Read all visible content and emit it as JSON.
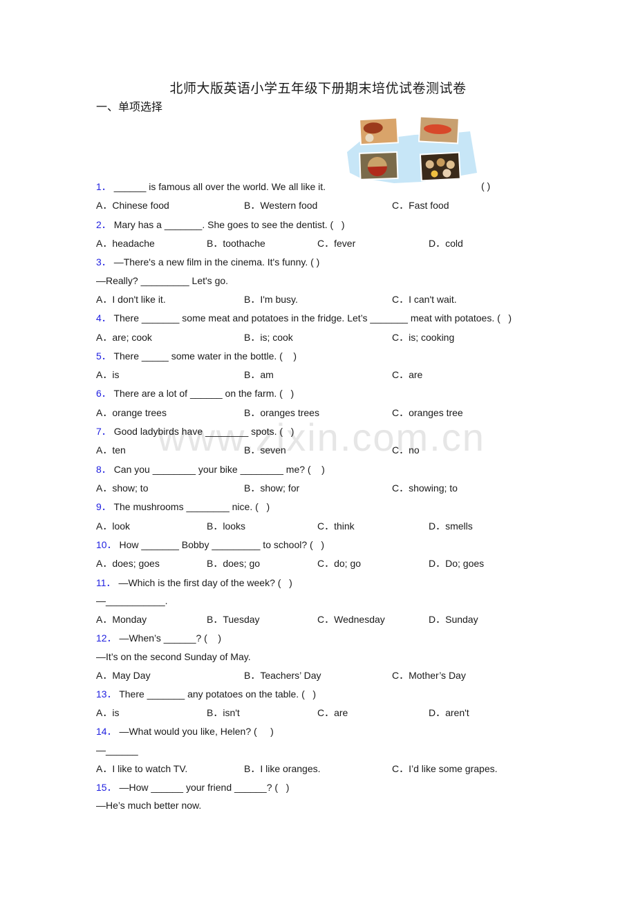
{
  "document": {
    "title": "北师大版英语小学五年级下册期末培优试卷测试卷",
    "section_heading": "一、单项选择",
    "watermark": "www.zixin.com.cn",
    "image_alt": "food-collage-image",
    "number_color": "#2020e0"
  },
  "questions": [
    {
      "num": "1．",
      "lines": [
        "______ is famous all over the world. We all like it."
      ],
      "trailing": "( )",
      "options": [
        "A．Chinese food",
        "B．Western food",
        "C．Fast food"
      ]
    },
    {
      "num": "2．",
      "lines": [
        "Mary has a _______. She goes to see the dentist. (   )"
      ],
      "options": [
        "A．headache",
        "B．toothache",
        "C．fever",
        "D．cold"
      ]
    },
    {
      "num": "3．",
      "lines": [
        "—There's a new film in the cinema. It's funny. ( )",
        "—Really? _________ Let's go."
      ],
      "options": [
        "A．I don't like it.",
        "B．I'm busy.",
        "C．I can't wait."
      ]
    },
    {
      "num": "4．",
      "lines": [
        "There _______ some meat and potatoes in the fridge. Let’s _______ meat with potatoes. (   )"
      ],
      "options": [
        "A．are; cook",
        "B．is; cook",
        "C．is; cooking"
      ]
    },
    {
      "num": "5．",
      "lines": [
        "There _____ some water in the bottle. (    )"
      ],
      "options": [
        "A．is",
        "B．am",
        "C．are"
      ]
    },
    {
      "num": "6．",
      "lines": [
        "There are a lot of ______ on the farm. (   )"
      ],
      "options": [
        "A．orange trees",
        "B．oranges trees",
        "C．oranges tree"
      ]
    },
    {
      "num": "7．",
      "lines": [
        "Good ladybirds have ________ spots. (   )"
      ],
      "options": [
        "A．ten",
        "B．seven",
        "C．no"
      ]
    },
    {
      "num": "8．",
      "lines": [
        "Can you ________ your bike ________ me? (    )"
      ],
      "options": [
        "A．show; to",
        "B．show; for",
        "C．showing; to"
      ]
    },
    {
      "num": "9．",
      "lines": [
        "The mushrooms ________ nice. (   )"
      ],
      "options": [
        "A．look",
        "B．looks",
        "C．think",
        "D．smells"
      ]
    },
    {
      "num": "10．",
      "lines": [
        "How _______ Bobby _________ to school? (   )"
      ],
      "options": [
        "A．does; goes",
        "B．does; go",
        "C．do; go",
        "D．Do; goes"
      ]
    },
    {
      "num": "11．",
      "lines": [
        "—Which is the first day of the week? (   )",
        "—___________."
      ],
      "options": [
        "A．Monday",
        "B．Tuesday",
        "C．Wednesday",
        "D．Sunday"
      ]
    },
    {
      "num": "12．",
      "lines": [
        "—When’s ______? (    )",
        "—It’s on the second Sunday of May."
      ],
      "options": [
        "A．May Day",
        "B．Teachers’ Day",
        "C．Mother’s Day"
      ]
    },
    {
      "num": "13．",
      "lines": [
        "There _______ any potatoes on the table. (   )"
      ],
      "options": [
        "A．is",
        "B．isn't",
        "C．are",
        "D．aren't"
      ]
    },
    {
      "num": "14．",
      "lines": [
        "—What would you like, Helen? (     )",
        "—______"
      ],
      "options": [
        "A．I like to watch TV.",
        "B．I like oranges.",
        "C．I’d like some grapes."
      ]
    },
    {
      "num": "15．",
      "lines": [
        "—How ______ your friend ______? (   )",
        "—He’s much better now."
      ],
      "options": []
    }
  ]
}
